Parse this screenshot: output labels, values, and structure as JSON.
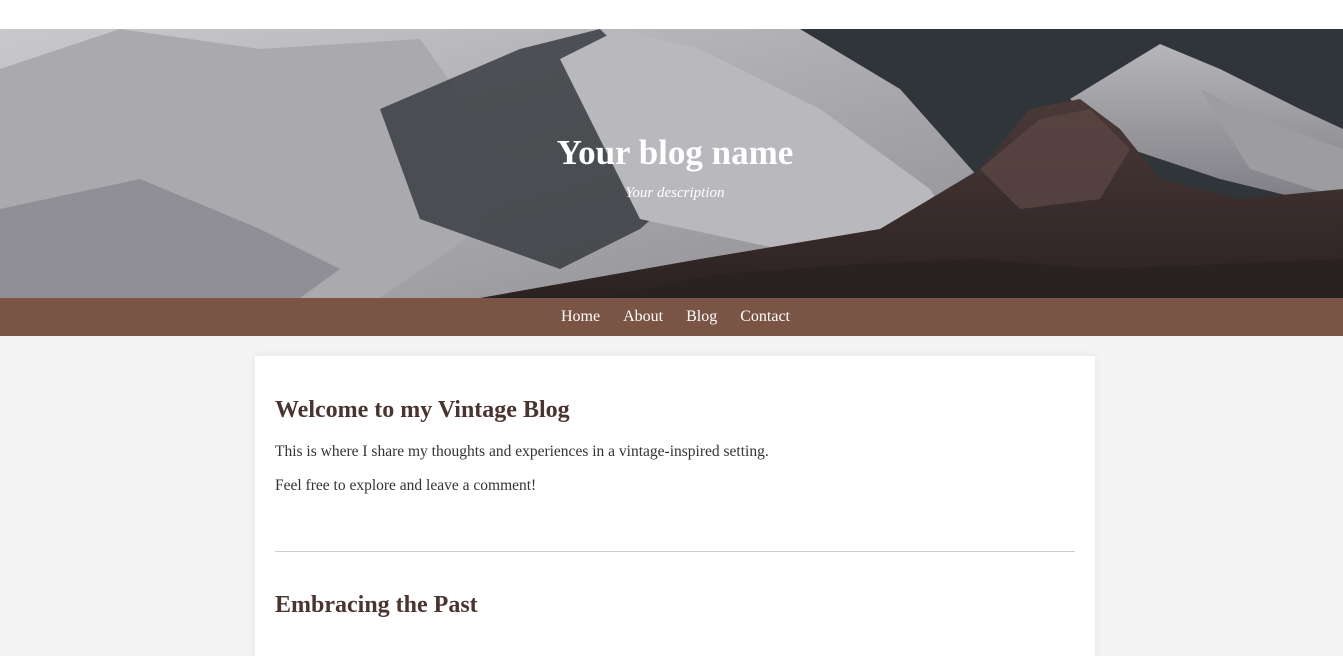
{
  "header": {
    "blog_name": "Your blog name",
    "description": "Your description"
  },
  "nav": {
    "items": [
      {
        "label": "Home"
      },
      {
        "label": "About"
      },
      {
        "label": "Blog"
      },
      {
        "label": "Contact"
      }
    ]
  },
  "posts": [
    {
      "title": "Welcome to my Vintage Blog",
      "paragraphs": [
        "This is where I share my thoughts and experiences in a vintage-inspired setting.",
        "Feel free to explore and leave a comment!"
      ]
    },
    {
      "title": "Embracing the Past"
    }
  ],
  "colors": {
    "nav_background": "#7a5445",
    "heading_color": "#4a3430",
    "page_background": "#f4f4f4"
  }
}
